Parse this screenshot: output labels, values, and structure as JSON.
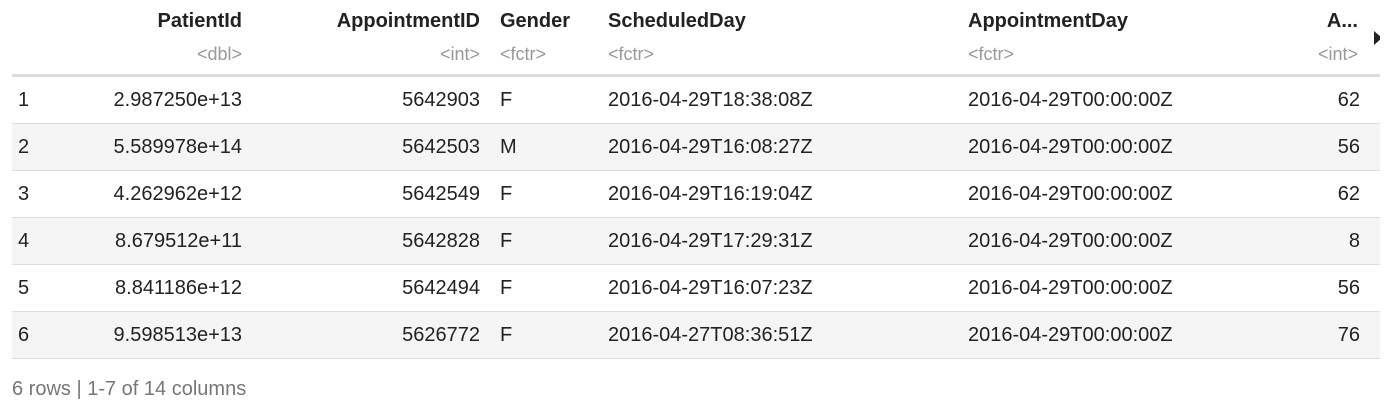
{
  "columns": [
    {
      "name": "PatientId",
      "type": "<dbl>"
    },
    {
      "name": "AppointmentID",
      "type": "<int>"
    },
    {
      "name": "Gender",
      "type": "<fctr>"
    },
    {
      "name": "ScheduledDay",
      "type": "<fctr>"
    },
    {
      "name": "AppointmentDay",
      "type": "<fctr>"
    },
    {
      "name": "A...",
      "type": "<int>"
    }
  ],
  "rows": [
    {
      "index": "1",
      "patient_id": "2.987250e+13",
      "appointment_id": "5642903",
      "gender": "F",
      "scheduled_day": "2016-04-29T18:38:08Z",
      "appointment_day": "2016-04-29T00:00:00Z",
      "age": "62"
    },
    {
      "index": "2",
      "patient_id": "5.589978e+14",
      "appointment_id": "5642503",
      "gender": "M",
      "scheduled_day": "2016-04-29T16:08:27Z",
      "appointment_day": "2016-04-29T00:00:00Z",
      "age": "56"
    },
    {
      "index": "3",
      "patient_id": "4.262962e+12",
      "appointment_id": "5642549",
      "gender": "F",
      "scheduled_day": "2016-04-29T16:19:04Z",
      "appointment_day": "2016-04-29T00:00:00Z",
      "age": "62"
    },
    {
      "index": "4",
      "patient_id": "8.679512e+11",
      "appointment_id": "5642828",
      "gender": "F",
      "scheduled_day": "2016-04-29T17:29:31Z",
      "appointment_day": "2016-04-29T00:00:00Z",
      "age": "8"
    },
    {
      "index": "5",
      "patient_id": "8.841186e+12",
      "appointment_id": "5642494",
      "gender": "F",
      "scheduled_day": "2016-04-29T16:07:23Z",
      "appointment_day": "2016-04-29T00:00:00Z",
      "age": "56"
    },
    {
      "index": "6",
      "patient_id": "9.598513e+13",
      "appointment_id": "5626772",
      "gender": "F",
      "scheduled_day": "2016-04-27T08:36:51Z",
      "appointment_day": "2016-04-29T00:00:00Z",
      "age": "76"
    }
  ],
  "footer": {
    "summary": "6 rows | 1-7 of 14 columns"
  },
  "icons": {
    "next_columns": "triangle-right-icon"
  },
  "colors": {
    "header_text": "#222222",
    "type_text": "#999999",
    "stripe": "#f5f5f5",
    "border": "#dddddd",
    "footer_text": "#777777"
  }
}
